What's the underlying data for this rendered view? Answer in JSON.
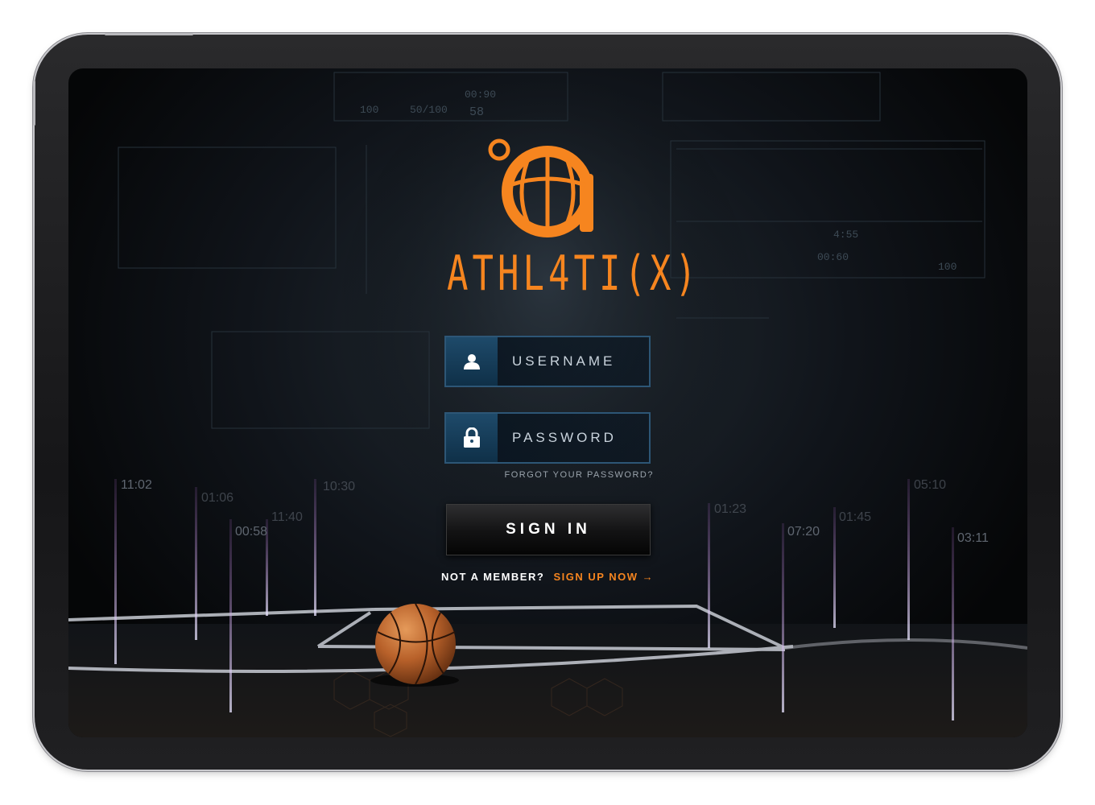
{
  "app": {
    "logo_text": "ATHL4TI(X)"
  },
  "login": {
    "username_placeholder": "USERNAME",
    "password_placeholder": "PASSWORD",
    "forgot_label": "FORGOT YOUR PASSWORD?",
    "signin_label": "SIGN IN",
    "member_question": "NOT A MEMBER?",
    "signup_label": "SIGN UP NOW",
    "signup_arrow": "→"
  },
  "background": {
    "timers": [
      "11:02",
      "01:06",
      "00:58",
      "11:40",
      "10:30",
      "01:23",
      "07:20",
      "01:45",
      "05:10",
      "03:11"
    ],
    "hud_readouts": [
      "100",
      "50/100",
      "58",
      "00:90",
      "00:60",
      "4:55"
    ]
  },
  "colors": {
    "brand_orange": "#f6851f",
    "field_border": "#2d5676",
    "icon_bg": "#1e4a6a"
  },
  "icons": {
    "username": "user-icon",
    "password": "lock-icon",
    "logo": "basketball-logo-icon"
  }
}
